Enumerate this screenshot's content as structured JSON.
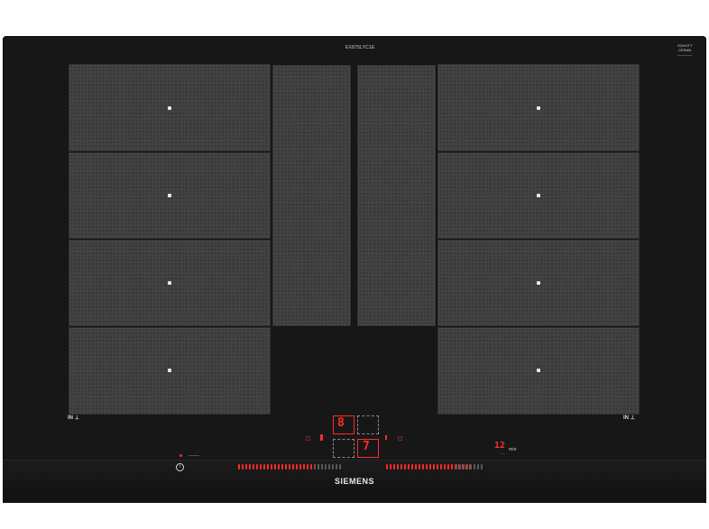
{
  "model_code": "EX875LYC1E",
  "badge": {
    "line1": "SCHOTT",
    "line2": "CERAN",
    "line3": "————"
  },
  "in_label_left": "IN",
  "in_label_right": "IN",
  "display": {
    "left_digit": "8",
    "right_digit": "7",
    "timer": "12",
    "timer_unit": "min",
    "timer_sub": "◦◦◦"
  },
  "brand": "SIEMENS",
  "icons": [
    "power-icon",
    "induction-symbol-icon"
  ],
  "colors": {
    "surface": "#171717",
    "zone": "#424242",
    "display": "#ff2a2a"
  }
}
